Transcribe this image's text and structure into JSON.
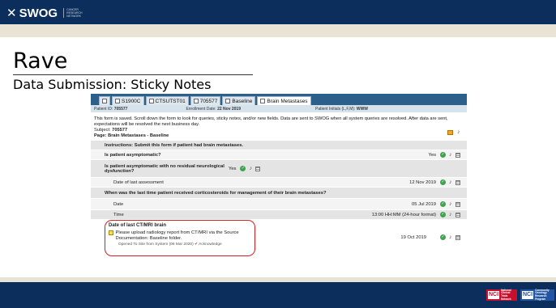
{
  "header": {
    "logo_text": "SWOG",
    "logo_subtext": "CANCER RESEARCH NETWORK"
  },
  "slide": {
    "title": "Rave",
    "subtitle": "Data Submission: Sticky Notes"
  },
  "tabs": [
    {
      "label": "",
      "icon": "home-icon"
    },
    {
      "label": "S1900C",
      "icon": "page-icon"
    },
    {
      "label": "CTSUTST01",
      "icon": "site-icon"
    },
    {
      "label": "705577",
      "icon": "person-icon"
    },
    {
      "label": "Baseline",
      "icon": "folder-icon"
    },
    {
      "label": "Brain Metastases",
      "icon": "form-icon"
    }
  ],
  "patient_bar": {
    "patient_id_label": "Patient ID:",
    "patient_id": "705577",
    "enrollment_label": "Enrollment Date:",
    "enrollment_date": "22 Nov 2019",
    "initials_label": "Patient Initials (L,F,M):",
    "initials": "WWW"
  },
  "notice": "This form is saved. Scroll down the form to look for queries, sticky notes, and/or new fields. Data are sent to SWOG when all system queries are resolved. After data are sent, expectations will be resolved the next business day.",
  "subject": {
    "subject_label": "Subject:",
    "subject_value": "705577",
    "page_label": "Page:",
    "page_value": "Brain Metastases - Baseline"
  },
  "rows": [
    {
      "label": "Instructions: Submit this form if patient had brain metastases.",
      "value": "",
      "style": "grey",
      "bold": true,
      "actions": false,
      "deep": false
    },
    {
      "label": "Is patient asymptomatic?",
      "value": "Yes",
      "style": "white",
      "bold": true,
      "actions": true,
      "deep": false
    },
    {
      "label": "Is patient asymptomatic with no residual neurological dysfunction?",
      "value": "Yes",
      "style": "grey",
      "bold": true,
      "actions": true,
      "deep": false
    },
    {
      "label": "Date of last assessment",
      "value": "12 Nov 2019",
      "style": "white",
      "bold": false,
      "actions": true,
      "deep": true
    },
    {
      "label": "When was the last time patient received corticosteroids for management of their brain metastases?",
      "value": "",
      "style": "grey",
      "bold": true,
      "actions": false,
      "deep": false
    },
    {
      "label": "Date",
      "value": "05 Jul 2019",
      "style": "white",
      "bold": false,
      "actions": true,
      "deep": true
    },
    {
      "label": "Time",
      "value": "13:00 HH:MM (24-hour format)",
      "style": "grey",
      "bold": false,
      "actions": true,
      "deep": true
    }
  ],
  "last_field": {
    "label": "Date of last CT/MRI brain",
    "sticky_text": "Please upload radiology report from CT/MRI via the Source Documentation: Baseline folder.",
    "opened_text": "Opened To Site from System (06 Mar 2020)",
    "acknowledge_label": "Acknowledge",
    "value": "19 Oct 2019"
  },
  "footer": {
    "nci1_box": "NCI",
    "nci1_text": "National Clinical Trials Network",
    "nci2_box": "NCI",
    "nci2_text": "Community Oncology Research Program"
  }
}
